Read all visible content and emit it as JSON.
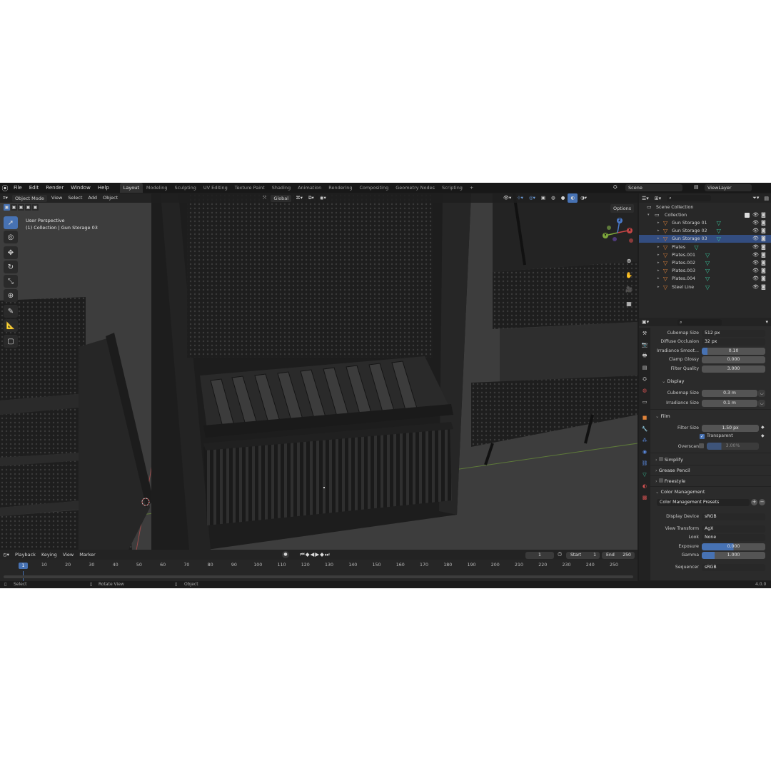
{
  "topbar": {
    "menus": [
      "File",
      "Edit",
      "Render",
      "Window",
      "Help"
    ],
    "workspaces": [
      "Layout",
      "Modeling",
      "Sculpting",
      "UV Editing",
      "Texture Paint",
      "Shading",
      "Animation",
      "Rendering",
      "Compositing",
      "Geometry Nodes",
      "Scripting"
    ],
    "active_workspace": "Layout",
    "add_tab": "+",
    "scene": "Scene",
    "view_layer": "ViewLayer"
  },
  "viewport": {
    "mode": "Object Mode",
    "menus": [
      "View",
      "Select",
      "Add",
      "Object"
    ],
    "transform_orientation": "Global",
    "options": "Options",
    "perspective": "User Perspective",
    "collection_info": "(1) Collection | Gun Storage 03",
    "gizmo_axes": {
      "x": "X",
      "y": "Y",
      "z": "Z"
    }
  },
  "outliner": {
    "root": "Scene Collection",
    "collection": "Collection",
    "items": [
      {
        "name": "Gun Storage 01"
      },
      {
        "name": "Gun Storage 02"
      },
      {
        "name": "Gun Storage 03"
      },
      {
        "name": "Plates"
      },
      {
        "name": "Plates.001"
      },
      {
        "name": "Plates.002"
      },
      {
        "name": "Plates.003"
      },
      {
        "name": "Plates.004"
      },
      {
        "name": "Steel Line"
      }
    ],
    "selected_index": 2
  },
  "properties": {
    "rows": {
      "cubemap_size_label": "Cubemap Size",
      "cubemap_size": "512 px",
      "diffuse_occlusion_label": "Diffuse Occlusion",
      "diffuse_occlusion": "32 px",
      "irradiance_smooth_label": "Irradiance Smoot...",
      "irradiance_smooth": "0.10",
      "clamp_glossy_label": "Clamp Glossy",
      "clamp_glossy": "0.000",
      "filter_quality_label": "Filter Quality",
      "filter_quality": "3.000"
    },
    "display": {
      "title": "Display",
      "cubemap_size_label": "Cubemap Size",
      "cubemap_size": "0.3 m",
      "irradiance_size_label": "Irradiance Size",
      "irradiance_size": "0.1 m"
    },
    "film": {
      "title": "Film",
      "filter_size_label": "Filter Size",
      "filter_size": "1.50 px",
      "transparent_label": "Transparent",
      "overscan_label": "Overscan",
      "overscan": "3.00%"
    },
    "sections": {
      "simplify": "Simplify",
      "grease_pencil": "Grease Pencil",
      "freestyle": "Freestyle"
    },
    "color_management": {
      "title": "Color Management",
      "presets": "Color Management Presets",
      "display_device_label": "Display Device",
      "display_device": "sRGB",
      "view_transform_label": "View Transform",
      "view_transform": "AgX",
      "look_label": "Look",
      "look": "None",
      "exposure_label": "Exposure",
      "exposure": "0.000",
      "gamma_label": "Gamma",
      "gamma": "1.000",
      "sequencer_label": "Sequencer",
      "sequencer": "sRGB"
    }
  },
  "timeline": {
    "menus": [
      "Playback",
      "Keying",
      "View",
      "Marker"
    ],
    "current_frame": "1",
    "start_label": "Start",
    "start": "1",
    "end_label": "End",
    "end": "250",
    "ticks": [
      "1",
      "10",
      "20",
      "30",
      "40",
      "50",
      "60",
      "70",
      "80",
      "90",
      "100",
      "110",
      "120",
      "130",
      "140",
      "150",
      "160",
      "170",
      "180",
      "190",
      "200",
      "210",
      "220",
      "230",
      "240",
      "250"
    ],
    "playhead": "1"
  },
  "statusbar": {
    "select": "Select",
    "rotate": "Rotate View",
    "object": "Object",
    "version": "4.0.0"
  },
  "colors": {
    "accent": "#4772b3",
    "object_orange": "#e0833a",
    "modifier_teal": "#38c99e"
  }
}
